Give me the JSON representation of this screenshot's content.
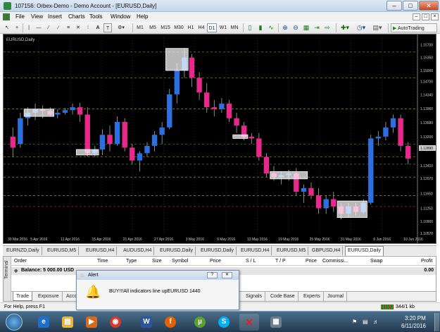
{
  "window": {
    "title": "107156: Orbex-Demo - Demo Account - [EURUSD,Daily]",
    "minimize": "–",
    "maximize": "□",
    "close": "✕"
  },
  "menu": {
    "items": [
      "File",
      "View",
      "Insert",
      "Charts",
      "Tools",
      "Window",
      "Help"
    ],
    "mdi_buttons": [
      "–",
      "□",
      "×"
    ]
  },
  "toolbar": {
    "timeframes": [
      "M1",
      "M5",
      "M15",
      "M30",
      "H1",
      "H4",
      "D1",
      "W1",
      "MN"
    ],
    "text_tool": "A",
    "label_tool": "T",
    "autotrading_label": "AutoTrading"
  },
  "chart": {
    "label": "EURUSD,Daily",
    "price_labels": [
      "1.15700",
      "1.15350",
      "1.15000",
      "1.14700",
      "1.14340",
      "1.13960",
      "1.13580",
      "1.13200",
      "1.12890",
      "1.12410",
      "1.12070",
      "1.11650",
      "1.11250",
      "1.10900",
      "1.10570"
    ],
    "current_price": "1.12890",
    "date_labels": [
      "30 Mar 2016",
      "5 Apr 2016",
      "11 Apr 2016",
      "15 Apr 2016",
      "21 Apr 2016",
      "27 Apr 2016",
      "3 May 2016",
      "9 May 2016",
      "13 May 2016",
      "19 May 2016",
      "25 May 2016",
      "31 May 2016",
      "6 Jun 2016",
      "10 Jun 2016"
    ]
  },
  "chart_data": {
    "type": "candlestick",
    "symbol": "EURUSD",
    "timeframe": "Daily",
    "ylim": [
      1.1057,
      1.159
    ],
    "candles": [
      {
        "o": 1.132,
        "h": 1.1345,
        "l": 1.1265,
        "c": 1.129
      },
      {
        "o": 1.13,
        "h": 1.1385,
        "l": 1.129,
        "c": 1.137
      },
      {
        "o": 1.137,
        "h": 1.14,
        "l": 1.135,
        "c": 1.1385
      },
      {
        "o": 1.1385,
        "h": 1.141,
        "l": 1.1365,
        "c": 1.1395
      },
      {
        "o": 1.1395,
        "h": 1.1405,
        "l": 1.137,
        "c": 1.139
      },
      {
        "o": 1.139,
        "h": 1.14,
        "l": 1.1375,
        "c": 1.138
      },
      {
        "o": 1.138,
        "h": 1.1395,
        "l": 1.137,
        "c": 1.1385
      },
      {
        "o": 1.1385,
        "h": 1.1398,
        "l": 1.138,
        "c": 1.1392
      },
      {
        "o": 1.1392,
        "h": 1.141,
        "l": 1.138,
        "c": 1.14
      },
      {
        "o": 1.14,
        "h": 1.1412,
        "l": 1.136,
        "c": 1.138
      },
      {
        "o": 1.138,
        "h": 1.14,
        "l": 1.1265,
        "c": 1.1275
      },
      {
        "o": 1.1275,
        "h": 1.1295,
        "l": 1.1265,
        "c": 1.1285
      },
      {
        "o": 1.1285,
        "h": 1.134,
        "l": 1.127,
        "c": 1.1325
      },
      {
        "o": 1.1325,
        "h": 1.135,
        "l": 1.128,
        "c": 1.13
      },
      {
        "o": 1.13,
        "h": 1.1375,
        "l": 1.1295,
        "c": 1.136
      },
      {
        "o": 1.136,
        "h": 1.137,
        "l": 1.128,
        "c": 1.129
      },
      {
        "o": 1.129,
        "h": 1.13,
        "l": 1.1245,
        "c": 1.1255
      },
      {
        "o": 1.1255,
        "h": 1.128,
        "l": 1.1225,
        "c": 1.1275
      },
      {
        "o": 1.1275,
        "h": 1.1305,
        "l": 1.1265,
        "c": 1.1295
      },
      {
        "o": 1.1295,
        "h": 1.1335,
        "l": 1.128,
        "c": 1.1325
      },
      {
        "o": 1.1325,
        "h": 1.136,
        "l": 1.13,
        "c": 1.1345
      },
      {
        "o": 1.1345,
        "h": 1.145,
        "l": 1.134,
        "c": 1.1435
      },
      {
        "o": 1.1435,
        "h": 1.152,
        "l": 1.141,
        "c": 1.15
      },
      {
        "o": 1.15,
        "h": 1.156,
        "l": 1.148,
        "c": 1.1535
      },
      {
        "o": 1.1535,
        "h": 1.1545,
        "l": 1.1455,
        "c": 1.148
      },
      {
        "o": 1.148,
        "h": 1.1495,
        "l": 1.142,
        "c": 1.144
      },
      {
        "o": 1.144,
        "h": 1.1465,
        "l": 1.1385,
        "c": 1.14
      },
      {
        "o": 1.14,
        "h": 1.142,
        "l": 1.1375,
        "c": 1.1395
      },
      {
        "o": 1.1395,
        "h": 1.1425,
        "l": 1.1385,
        "c": 1.141
      },
      {
        "o": 1.141,
        "h": 1.142,
        "l": 1.136,
        "c": 1.137
      },
      {
        "o": 1.137,
        "h": 1.1385,
        "l": 1.133,
        "c": 1.135
      },
      {
        "o": 1.135,
        "h": 1.136,
        "l": 1.131,
        "c": 1.132
      },
      {
        "o": 1.132,
        "h": 1.133,
        "l": 1.13,
        "c": 1.1315
      },
      {
        "o": 1.1315,
        "h": 1.133,
        "l": 1.1255,
        "c": 1.1265
      },
      {
        "o": 1.1265,
        "h": 1.1275,
        "l": 1.121,
        "c": 1.122
      },
      {
        "o": 1.122,
        "h": 1.124,
        "l": 1.12,
        "c": 1.121
      },
      {
        "o": 1.121,
        "h": 1.1225,
        "l": 1.119,
        "c": 1.1215
      },
      {
        "o": 1.1215,
        "h": 1.123,
        "l": 1.12,
        "c": 1.122
      },
      {
        "o": 1.122,
        "h": 1.1235,
        "l": 1.116,
        "c": 1.117
      },
      {
        "o": 1.117,
        "h": 1.119,
        "l": 1.114,
        "c": 1.118
      },
      {
        "o": 1.118,
        "h": 1.1195,
        "l": 1.115,
        "c": 1.116
      },
      {
        "o": 1.116,
        "h": 1.118,
        "l": 1.111,
        "c": 1.1125
      },
      {
        "o": 1.1125,
        "h": 1.116,
        "l": 1.111,
        "c": 1.115
      },
      {
        "o": 1.115,
        "h": 1.117,
        "l": 1.1115,
        "c": 1.113
      },
      {
        "o": 1.113,
        "h": 1.114,
        "l": 1.1095,
        "c": 1.111
      },
      {
        "o": 1.111,
        "h": 1.114,
        "l": 1.11,
        "c": 1.113
      },
      {
        "o": 1.113,
        "h": 1.114,
        "l": 1.1105,
        "c": 1.1115
      },
      {
        "o": 1.1115,
        "h": 1.115,
        "l": 1.111,
        "c": 1.114
      },
      {
        "o": 1.114,
        "h": 1.1325,
        "l": 1.1135,
        "c": 1.1315
      },
      {
        "o": 1.1315,
        "h": 1.1335,
        "l": 1.1295,
        "c": 1.132
      },
      {
        "o": 1.132,
        "h": 1.136,
        "l": 1.131,
        "c": 1.1345
      },
      {
        "o": 1.1345,
        "h": 1.138,
        "l": 1.133,
        "c": 1.137
      },
      {
        "o": 1.137,
        "h": 1.138,
        "l": 1.128,
        "c": 1.1295
      },
      {
        "o": 1.1295,
        "h": 1.1305,
        "l": 1.1245,
        "c": 1.126
      }
    ]
  },
  "chart_tabs": [
    "EURNZD,Daily",
    "EURUSD,M5",
    "EURUSD,H4",
    "AUDUSD,H4",
    "EURUSD,Daily",
    "EURUSD,Daily",
    "EURUSD,H4",
    "EURUSD,M5",
    "GBPUSD,H4",
    "EURUSD,Daily"
  ],
  "terminal": {
    "side_label": "Terminal",
    "columns": [
      "Order",
      "Time",
      "Type",
      "Size",
      "Symbol",
      "Price",
      "S / L",
      "T / P",
      "Price",
      "Commissi...",
      "Swap",
      "Profit"
    ],
    "balance_label": "Balance: 5 000.00 USD",
    "balance_value": "0.00",
    "tabs": [
      "Trade",
      "Exposure",
      "Acco",
      "Signals",
      "Code Base",
      "Experts",
      "Journal"
    ]
  },
  "alert": {
    "title": "Alert",
    "help_btn": "?",
    "close_btn": "✕",
    "message": "BUY!!!All indicators line upEURUSD 1440"
  },
  "status": {
    "help_text": "For Help, press F1",
    "traffic": "344/1 kb"
  },
  "taskbar": {
    "time": "3:20 PM",
    "date": "6/11/2016",
    "apps": [
      "ie-icon",
      "folder-icon",
      "media-player-icon",
      "chrome-icon",
      "word-icon",
      "firefox-icon",
      "utorrent-icon",
      "skype-icon",
      "close-app-icon",
      "metatrader-icon"
    ]
  }
}
